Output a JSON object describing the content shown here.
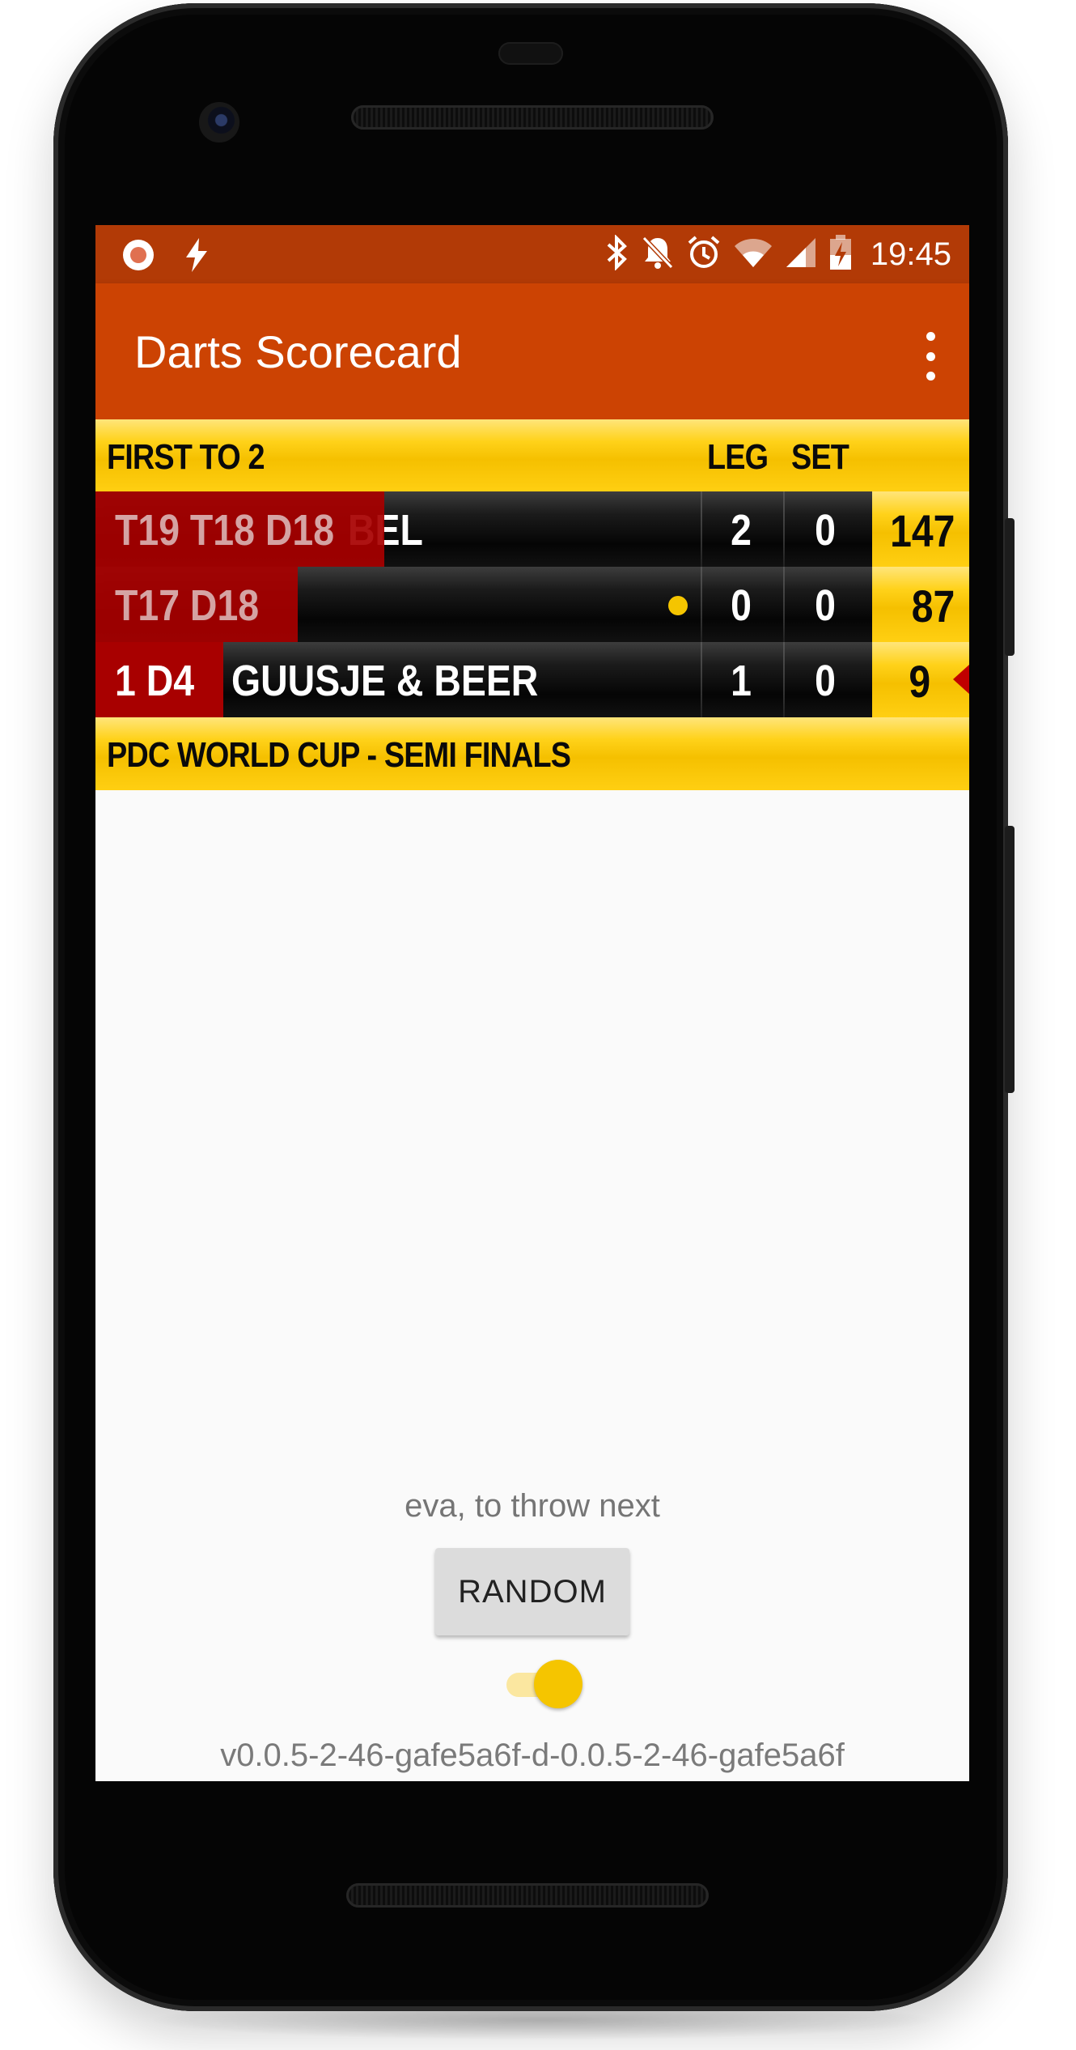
{
  "status_bar": {
    "time": "19:45",
    "left_icons": [
      "record-icon",
      "flash-icon"
    ],
    "right_icons": [
      "bluetooth-icon",
      "notifications-off-icon",
      "alarm-icon",
      "wifi-icon",
      "signal-icon",
      "battery-charging-icon"
    ]
  },
  "app_bar": {
    "title": "Darts Scorecard",
    "menu_icon": "more-vert-icon"
  },
  "scoreboard": {
    "header": {
      "format": "FIRST TO 2",
      "leg_label": "LEG",
      "set_label": "SET"
    },
    "rows": [
      {
        "checkout": "T19 T18 D18",
        "name": "BEL",
        "legs": "2",
        "sets": "0",
        "score": "147",
        "to_throw": false,
        "active": false
      },
      {
        "checkout": "T17 D18",
        "name": "",
        "legs": "0",
        "sets": "0",
        "score": "87",
        "to_throw": true,
        "active": false
      },
      {
        "checkout": "1 D4",
        "name": "GUUSJE & BEER",
        "legs": "1",
        "sets": "0",
        "score": "9",
        "to_throw": false,
        "active": true
      }
    ],
    "footer": "PDC WORLD CUP - SEMI FINALS"
  },
  "controls": {
    "next_text": "eva, to throw next",
    "random_label": "RANDOM",
    "toggle_on": true
  },
  "version": "v0.0.5-2-46-gafe5a6f-d-0.0.5-2-46-gafe5a6f",
  "colors": {
    "status_bar": "#b23a06",
    "app_bar": "#cc4303",
    "gold": "#ffd21a",
    "checkout_red": "#a80000",
    "accent_yellow": "#f5c500"
  }
}
